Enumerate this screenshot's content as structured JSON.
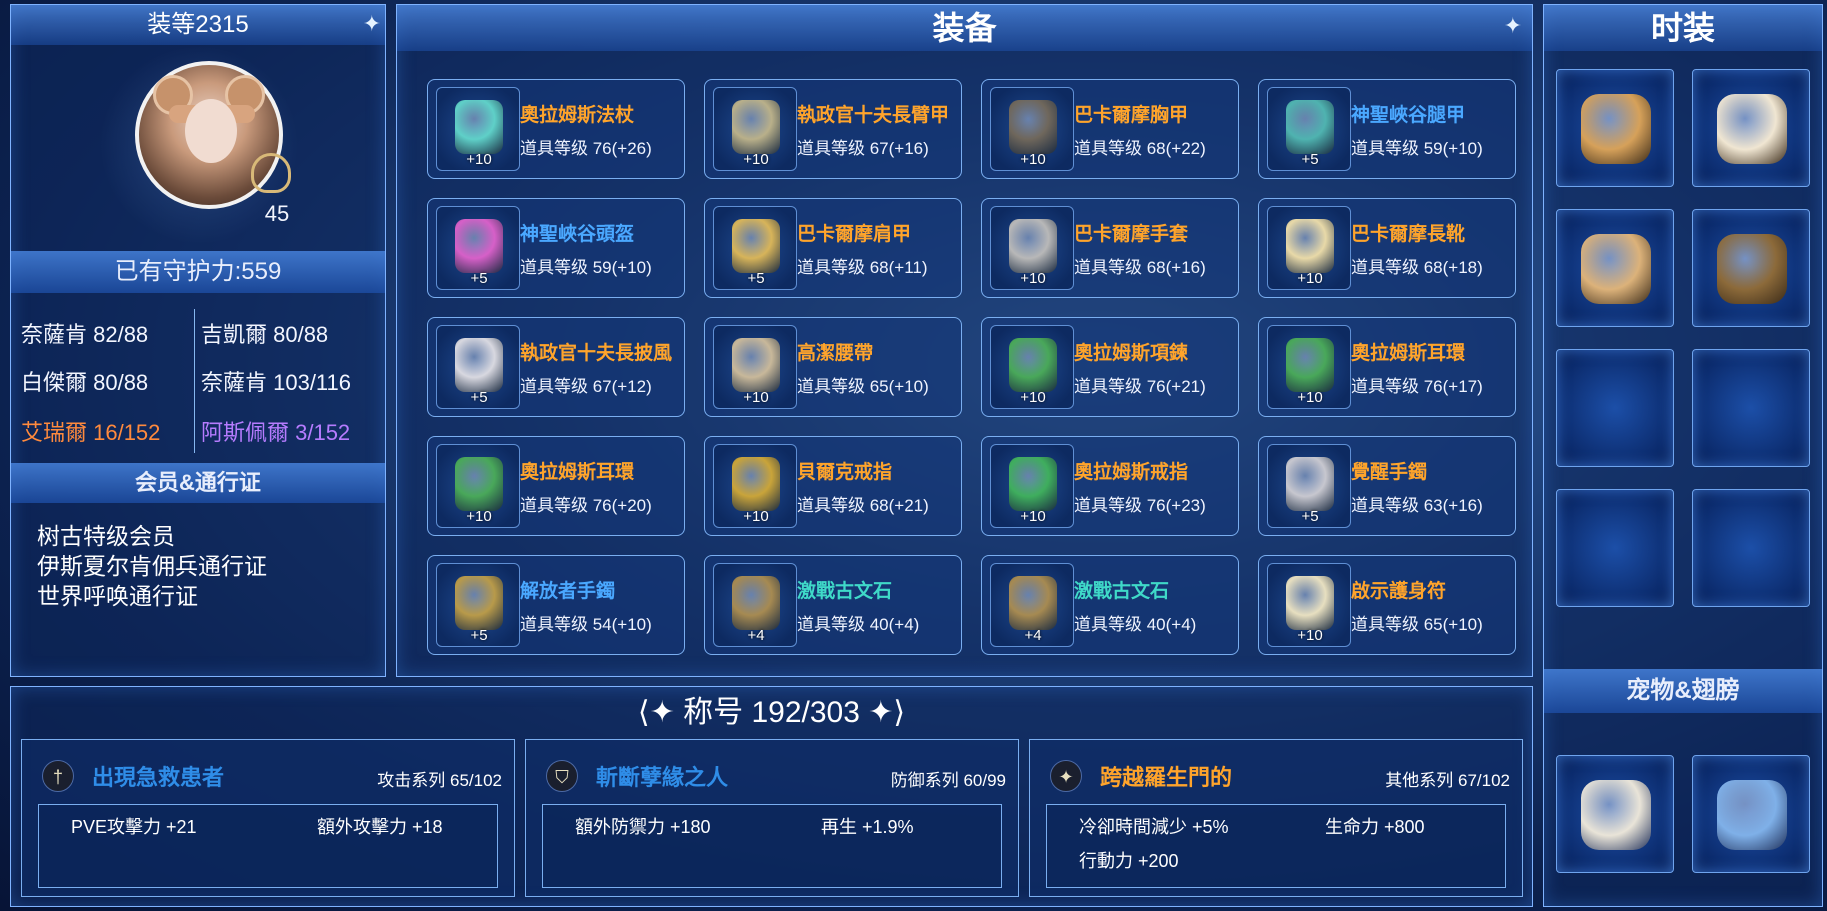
{
  "left_panel": {
    "gear_score": "装等2315",
    "level": "45",
    "guardian_power": "已有守护力:559",
    "reputations": [
      {
        "label": "奈薩肯 82/88",
        "color": "#f3f6ff"
      },
      {
        "label": "吉凱爾 80/88",
        "color": "#f3f6ff"
      },
      {
        "label": "白傑爾 80/88",
        "color": "#f3f6ff"
      },
      {
        "label": "奈薩肯 103/116",
        "color": "#f3f6ff"
      },
      {
        "label": "艾瑞爾 16/152",
        "color": "#ff8a3d"
      },
      {
        "label": "阿斯佩爾 3/152",
        "color": "#b67cff"
      }
    ],
    "membership_title": "会员&通行证",
    "memberships": [
      "树古特级会员",
      "伊斯夏尔肯佣兵通行证",
      "世界呼唤通行证"
    ]
  },
  "equipment": {
    "title": "装备",
    "items": [
      {
        "name": "奧拉姆斯法杖",
        "level": "道具等级 76(+26)",
        "enh": "+10",
        "name_color": "#ffa42b",
        "icon": "staff-icon",
        "icon_color": "#5fd0c8"
      },
      {
        "name": "執政官十夫長臂甲",
        "level": "道具等级 67(+16)",
        "enh": "+10",
        "name_color": "#ffa42b",
        "icon": "arm-guard-icon",
        "icon_color": "#b9b08a"
      },
      {
        "name": "巴卡爾摩胸甲",
        "level": "道具等级 68(+22)",
        "enh": "+10",
        "name_color": "#ffa42b",
        "icon": "chest-armor-icon",
        "icon_color": "#6f675c"
      },
      {
        "name": "神聖峽谷腿甲",
        "level": "道具等级 59(+10)",
        "enh": "+5",
        "name_color": "#4aa8ff",
        "icon": "leg-armor-icon",
        "icon_color": "#4fb3b0"
      },
      {
        "name": "神聖峽谷頭盔",
        "level": "道具等级 59(+10)",
        "enh": "+5",
        "name_color": "#4aa8ff",
        "icon": "helmet-icon",
        "icon_color": "#d660c8"
      },
      {
        "name": "巴卡爾摩肩甲",
        "level": "道具等级 68(+11)",
        "enh": "+5",
        "name_color": "#ffa42b",
        "icon": "shoulder-armor-icon",
        "icon_color": "#d7b45a"
      },
      {
        "name": "巴卡爾摩手套",
        "level": "道具等级 68(+16)",
        "enh": "+10",
        "name_color": "#ffa42b",
        "icon": "gloves-icon",
        "icon_color": "#b8b8b8"
      },
      {
        "name": "巴卡爾摩長靴",
        "level": "道具等级 68(+18)",
        "enh": "+10",
        "name_color": "#ffa42b",
        "icon": "boots-icon",
        "icon_color": "#e8d9a8"
      },
      {
        "name": "執政官十夫長披風",
        "level": "道具等级 67(+12)",
        "enh": "+5",
        "name_color": "#ffa42b",
        "icon": "cape-icon",
        "icon_color": "#d8d8e0"
      },
      {
        "name": "高潔腰帶",
        "level": "道具等级 65(+10)",
        "enh": "+10",
        "name_color": "#ffa42b",
        "icon": "belt-icon",
        "icon_color": "#c8b89a"
      },
      {
        "name": "奧拉姆斯項鍊",
        "level": "道具等级 76(+21)",
        "enh": "+10",
        "name_color": "#ffa42b",
        "icon": "necklace-icon",
        "icon_color": "#49a85a"
      },
      {
        "name": "奧拉姆斯耳環",
        "level": "道具等级 76(+17)",
        "enh": "+10",
        "name_color": "#ffa42b",
        "icon": "earring-icon",
        "icon_color": "#49a85a"
      },
      {
        "name": "奧拉姆斯耳環",
        "level": "道具等级 76(+20)",
        "enh": "+10",
        "name_color": "#ffa42b",
        "icon": "earring-icon",
        "icon_color": "#49a85a"
      },
      {
        "name": "貝爾克戒指",
        "level": "道具等级 68(+21)",
        "enh": "+10",
        "name_color": "#ffa42b",
        "icon": "ring-icon",
        "icon_color": "#c9a43a"
      },
      {
        "name": "奧拉姆斯戒指",
        "level": "道具等级 76(+23)",
        "enh": "+10",
        "name_color": "#ffa42b",
        "icon": "ring-icon",
        "icon_color": "#3fae5e"
      },
      {
        "name": "覺醒手鐲",
        "level": "道具等级 63(+16)",
        "enh": "+5",
        "name_color": "#ffa42b",
        "icon": "bracelet-icon",
        "icon_color": "#c7c7cf"
      },
      {
        "name": "解放者手鐲",
        "level": "道具等级 54(+10)",
        "enh": "+5",
        "name_color": "#4aa8ff",
        "icon": "bracelet-icon",
        "icon_color": "#b89a4a"
      },
      {
        "name": "激戰古文石",
        "level": "道具等级 40(+4)",
        "enh": "+4",
        "name_color": "#3fd9c8",
        "icon": "rune-stone-icon",
        "icon_color": "#a68a52"
      },
      {
        "name": "激戰古文石",
        "level": "道具等级 40(+4)",
        "enh": "+4",
        "name_color": "#3fd9c8",
        "icon": "rune-stone-icon",
        "icon_color": "#a68a52"
      },
      {
        "name": "啟示護身符",
        "level": "道具等级 65(+10)",
        "enh": "+10",
        "name_color": "#ffa42b",
        "icon": "amulet-icon",
        "icon_color": "#e7dfc0"
      }
    ]
  },
  "fashion": {
    "title": "时装",
    "slots": [
      {
        "icon": "shoes-icon",
        "color": "#d6a15a"
      },
      {
        "icon": "shirt-icon",
        "color": "#f0e6d2"
      },
      {
        "icon": "bear-ears-icon",
        "color": "#dcb27a"
      },
      {
        "icon": "bear-staff-icon",
        "color": "#8c6a3a"
      },
      {
        "icon": "",
        "color": ""
      },
      {
        "icon": "",
        "color": ""
      },
      {
        "icon": "",
        "color": ""
      },
      {
        "icon": "",
        "color": ""
      }
    ],
    "pet_title": "宠物&翅膀",
    "pets": [
      {
        "icon": "pet-icon",
        "color": "#e9e4d8"
      },
      {
        "icon": "wings-icon",
        "color": "#7fb0e8"
      }
    ]
  },
  "titles": {
    "header": "称号 192/303",
    "cards": [
      {
        "name": "出現急救患者",
        "name_color": "#2f8de8",
        "category": "攻击系列 65/102",
        "icon": "sword-icon",
        "stats": [
          "PVE攻擊力 +21",
          "額外攻擊力 +18"
        ]
      },
      {
        "name": "斬斷孽緣之人",
        "name_color": "#2f8de8",
        "category": "防御系列 60/99",
        "icon": "shield-icon",
        "stats": [
          "額外防禦力 +180",
          "再生 +1.9%"
        ]
      },
      {
        "name": "跨越羅生門的",
        "name_color": "#ffa42b",
        "category": "其他系列 67/102",
        "icon": "star-icon",
        "stats": [
          "冷卻時間減少 +5%",
          "生命力 +800",
          "行動力 +200"
        ]
      }
    ]
  }
}
